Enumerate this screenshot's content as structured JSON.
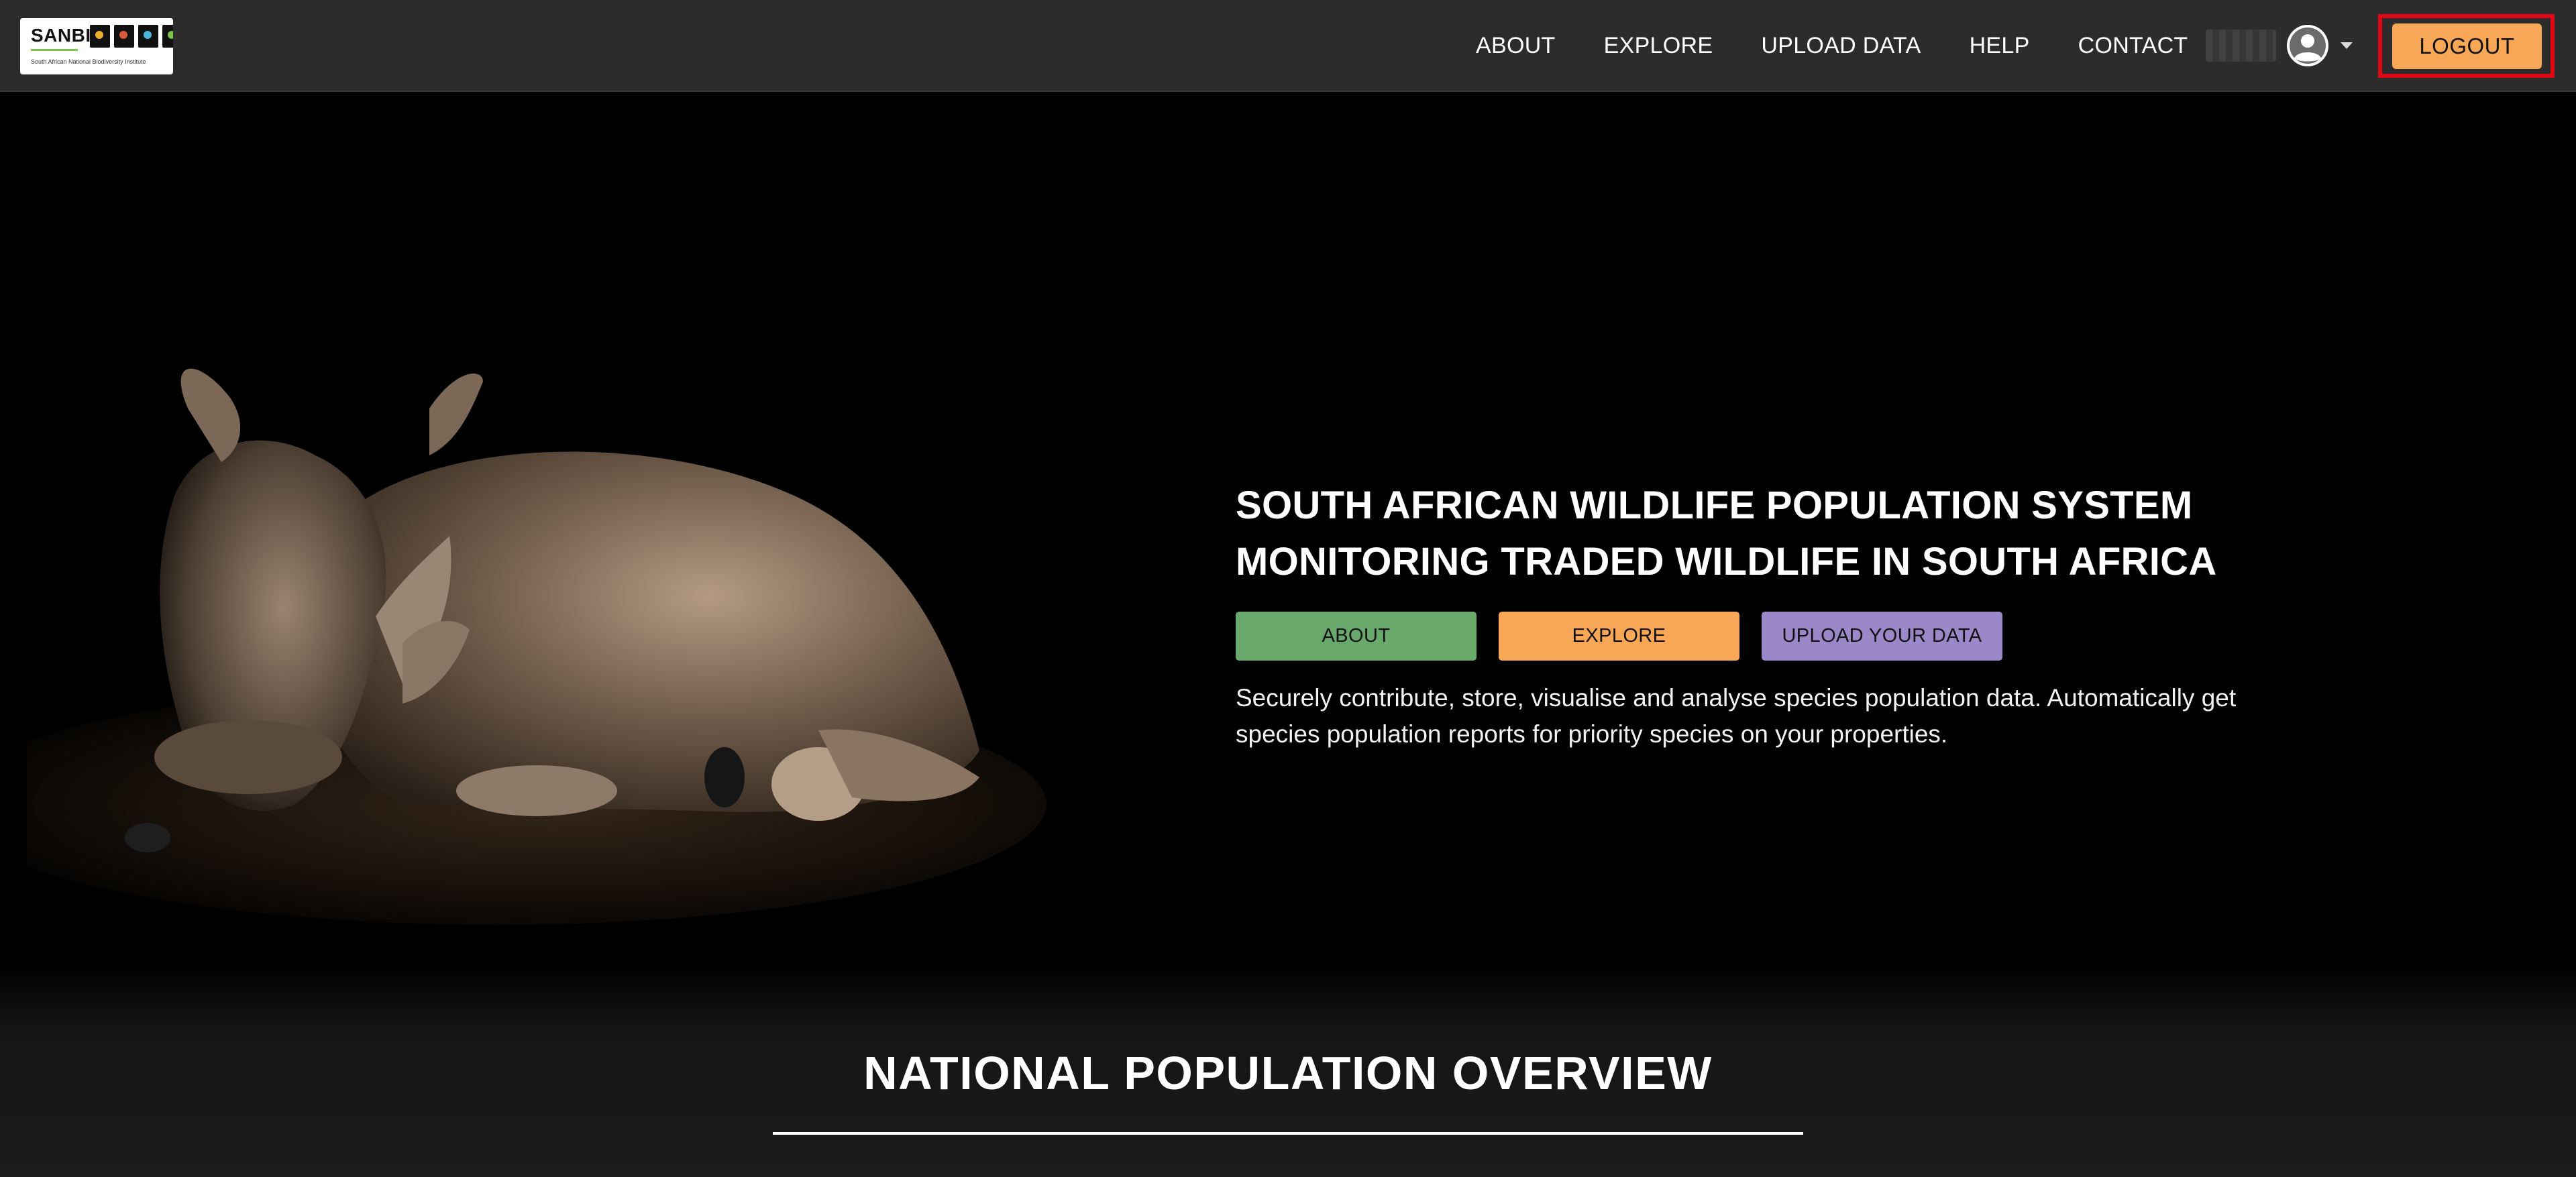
{
  "header": {
    "logo": {
      "title": "SANBI",
      "subtitle": "South African National Biodiversity Institute"
    },
    "nav": [
      {
        "label": "ABOUT"
      },
      {
        "label": "EXPLORE"
      },
      {
        "label": "UPLOAD DATA"
      },
      {
        "label": "HELP"
      },
      {
        "label": "CONTACT"
      }
    ],
    "user": {
      "avatar_icon": "user-circle-icon",
      "menu_icon": "caret-down-icon"
    },
    "logout_label": "LOGOUT",
    "highlight_color": "#e30613"
  },
  "hero": {
    "title_line1": "SOUTH AFRICAN WILDLIFE POPULATION SYSTEM",
    "title_line2": "MONITORING TRADED WILDLIFE IN SOUTH AFRICA",
    "buttons": [
      {
        "label": "ABOUT",
        "color": "#6aa96c"
      },
      {
        "label": "EXPLORE",
        "color": "#f7a756"
      },
      {
        "label": "UPLOAD YOUR DATA",
        "color": "#9a88c8"
      }
    ],
    "description": "Securely contribute, store, visualise and analyse species population data. Automatically get species population reports for priority species on your properties.",
    "image_subject": "rhino-lying-down-with-birds"
  },
  "overview": {
    "title": "NATIONAL POPULATION OVERVIEW"
  },
  "colors": {
    "navbar_bg": "#2c2c2c",
    "accent_orange": "#f7a756",
    "accent_green": "#6aa96c",
    "accent_purple": "#9a88c8"
  }
}
